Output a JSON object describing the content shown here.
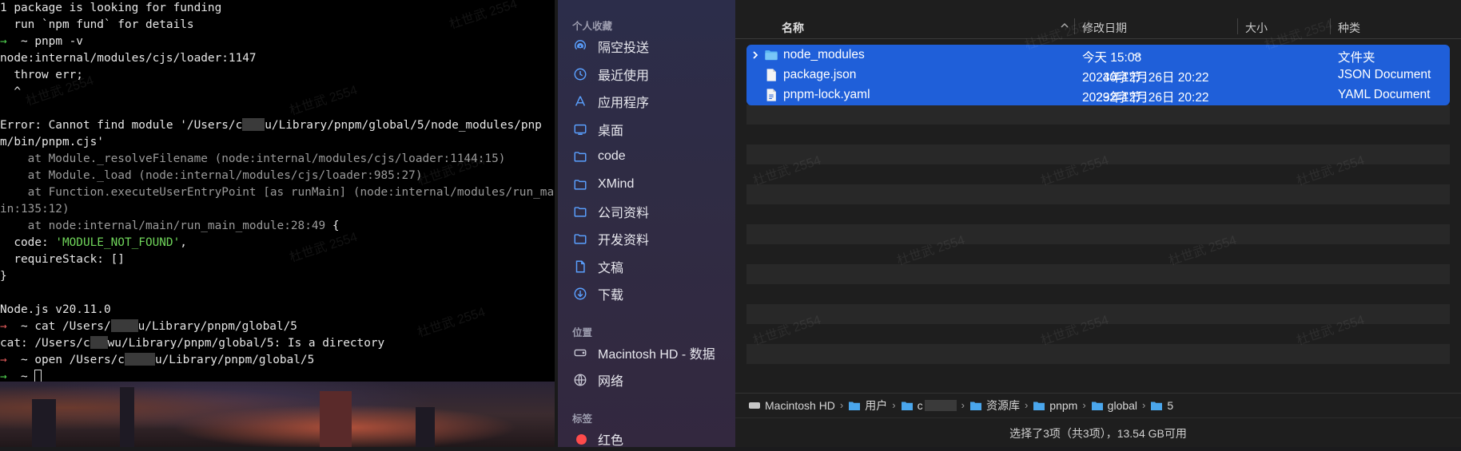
{
  "terminal": {
    "lines": {
      "l01": "1 package is looking for funding",
      "l02": "  run `npm fund` for details",
      "l03_prompt": "~ pnpm -v",
      "l04": "node:internal/modules/cjs/loader:1147",
      "l05": "  throw err;",
      "l06": "  ^",
      "l08a": "Error: Cannot find module '/Users/c",
      "l08b": "u/Library/pnpm/global/5/node_modules/pnp",
      "l09": "m/bin/pnpm.cjs'",
      "l10": "    at Module._resolveFilename (node:internal/modules/cjs/loader:1144:15)",
      "l11": "    at Module._load (node:internal/modules/cjs/loader:985:27)",
      "l12": "    at Function.executeUserEntryPoint [as runMain] (node:internal/modules/run_ma",
      "l13": "in:135:12)",
      "l14a": "    at node:internal/main/run_main_module:28:49",
      "l14b": " {",
      "l15a": "  code: ",
      "l15b": "'MODULE_NOT_FOUND'",
      "l15c": ",",
      "l16": "  requireStack: []",
      "l17": "}",
      "l19": "Node.js v20.11.0",
      "l20a": "~ cat /Users/",
      "l20b": "u/Library/pnpm/global/5",
      "l21a": "cat: /Users/c",
      "l21b": "wu/Library/pnpm/global/5: Is a directory",
      "l22a": "~ open /Users/c",
      "l22b": "u/Library/pnpm/global/5",
      "l23": "~ "
    }
  },
  "sidebar": {
    "favorites_header": "个人收藏",
    "favorites": [
      {
        "label": "隔空投送",
        "icon": "airdrop-icon"
      },
      {
        "label": "最近使用",
        "icon": "clock-icon"
      },
      {
        "label": "应用程序",
        "icon": "applications-icon"
      },
      {
        "label": "桌面",
        "icon": "desktop-icon"
      },
      {
        "label": "code",
        "icon": "folder-icon"
      },
      {
        "label": "XMind",
        "icon": "folder-icon"
      },
      {
        "label": "公司资料",
        "icon": "folder-icon"
      },
      {
        "label": "开发资料",
        "icon": "folder-icon"
      },
      {
        "label": "文稿",
        "icon": "document-icon"
      },
      {
        "label": "下载",
        "icon": "download-icon"
      }
    ],
    "locations_header": "位置",
    "locations": [
      {
        "label": "Macintosh HD - 数据",
        "icon": "disk-icon"
      },
      {
        "label": "网络",
        "icon": "globe-icon"
      }
    ],
    "tags_header": "标签",
    "tags": [
      {
        "label": "红色",
        "color": "#ff4b4b"
      }
    ]
  },
  "columns": {
    "name": "名称",
    "date": "修改日期",
    "size": "大小",
    "kind": "种类"
  },
  "files": [
    {
      "name": "node_modules",
      "date": "今天 15:08",
      "size": "--",
      "kind": "文件夹",
      "icon": "folder-icon"
    },
    {
      "name": "package.json",
      "date": "2023年12月26日 20:22",
      "size": "40字节",
      "kind": "JSON Document",
      "icon": "json-file-icon"
    },
    {
      "name": "pnpm-lock.yaml",
      "date": "2023年12月26日 20:22",
      "size": "292字节",
      "kind": "YAML Document",
      "icon": "yaml-file-icon"
    }
  ],
  "pathbar": {
    "items": [
      "Macintosh HD",
      "用户",
      "c",
      "资源库",
      "pnpm",
      "global",
      "5"
    ]
  },
  "status": "选择了3项（共3项），13.54 GB可用",
  "watermark": "杜世武 2554",
  "colors": {
    "selection": "#1f5fd9",
    "terminal_bg": "#000000",
    "prompt_ok": "#4fd14f",
    "prompt_err": "#e05a5a",
    "string": "#6fd45a"
  }
}
